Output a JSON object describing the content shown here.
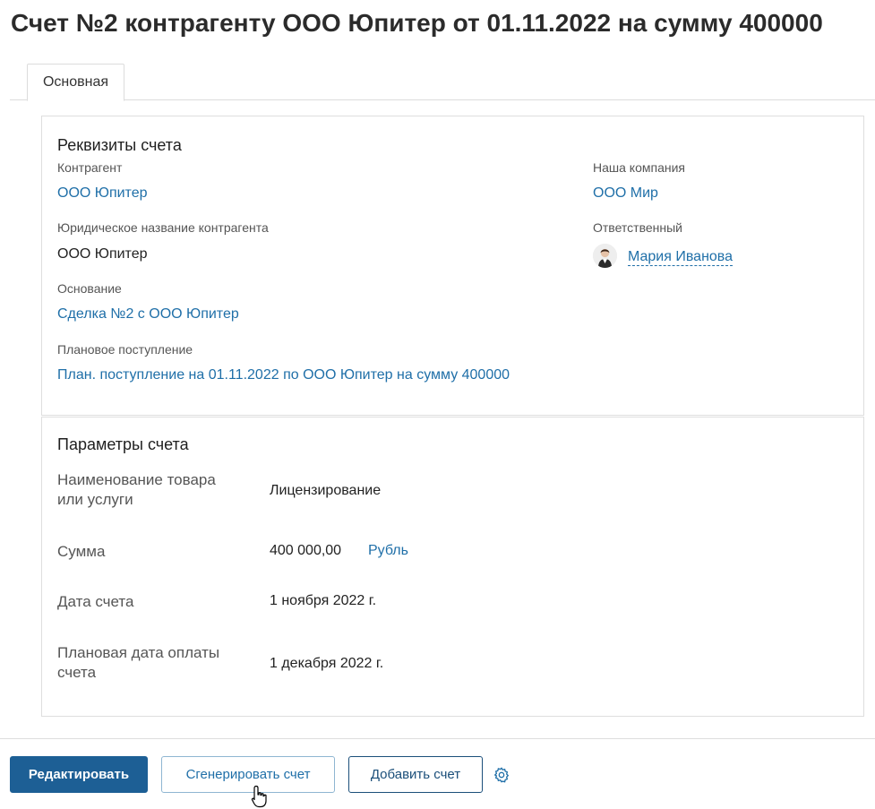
{
  "page": {
    "title": "Счет №2 контрагенту ООО Юпитер от 01.11.2022 на сумму 400000"
  },
  "tabs": [
    {
      "label": "Основная"
    }
  ],
  "requisites": {
    "title": "Реквизиты счета",
    "counterparty_label": "Контрагент",
    "counterparty_value": "ООО Юпитер",
    "legal_name_label": "Юридическое название контрагента",
    "legal_name_value": "ООО Юпитер",
    "basis_label": "Основание",
    "basis_value": "Сделка №2 с ООО Юпитер",
    "planned_receipt_label": "Плановое поступление",
    "planned_receipt_value": "План. поступление на 01.11.2022 по ООО Юпитер на сумму 400000",
    "our_company_label": "Наша компания",
    "our_company_value": "ООО Мир",
    "responsible_label": "Ответственный",
    "responsible_value": "Мария Иванова"
  },
  "parameters": {
    "title": "Параметры счета",
    "product_label_line1": "Наименование товара",
    "product_label_line2": "или услуги",
    "product_value": "Лицензирование",
    "amount_label": "Сумма",
    "amount_value": "400 000,00",
    "currency_value": "Рубль",
    "invoice_date_label": "Дата счета",
    "invoice_date_value": "1 ноября 2022 г.",
    "planned_payment_label_line1": "Плановая дата оплаты",
    "planned_payment_label_line2": "счета",
    "planned_payment_value": "1 декабря 2022 г."
  },
  "actions": {
    "edit_label": "Редактировать",
    "generate_label": "Сгенерировать счет",
    "add_label": "Добавить счет",
    "settings_icon": "gear-icon"
  },
  "colors": {
    "link": "#1f6fa8",
    "primary_button": "#1d5f95",
    "border": "#dedede"
  }
}
